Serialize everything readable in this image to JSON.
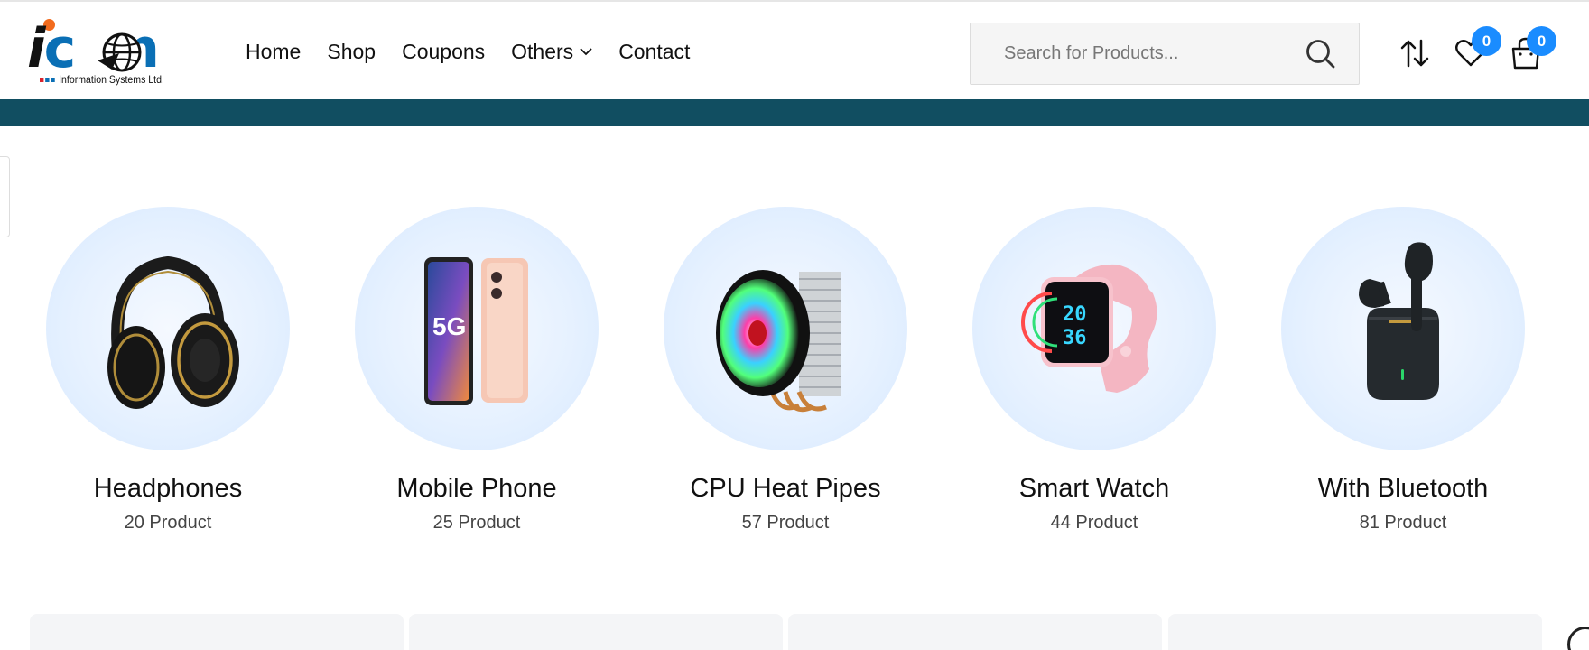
{
  "brand": {
    "logo_text": "icon",
    "tagline": "Information Systems Ltd.",
    "colors": {
      "primary": "#0a6fb5",
      "accent": "#f26b1d",
      "teal_bar": "#114e61",
      "badge": "#1a8cff"
    }
  },
  "nav": {
    "items": [
      {
        "label": "Home"
      },
      {
        "label": "Shop"
      },
      {
        "label": "Coupons"
      },
      {
        "label": "Others",
        "has_dropdown": true,
        "icon": "chevron-down-icon"
      },
      {
        "label": "Contact"
      }
    ]
  },
  "search": {
    "placeholder": "Search for Products...",
    "icon": "search-icon"
  },
  "header_actions": {
    "compare": {
      "icon": "compare-arrows-icon"
    },
    "wishlist": {
      "icon": "heart-icon",
      "count": "0"
    },
    "cart": {
      "icon": "shopping-bag-icon",
      "count": "0"
    }
  },
  "categories": [
    {
      "name": "Headphones",
      "count": "20 Product",
      "icon": "headphones-image"
    },
    {
      "name": "Mobile Phone",
      "count": "25 Product",
      "icon": "mobile-phone-image"
    },
    {
      "name": "CPU Heat Pipes",
      "count": "57 Product",
      "icon": "cpu-cooler-image"
    },
    {
      "name": "Smart Watch",
      "count": "44 Product",
      "icon": "smart-watch-image"
    },
    {
      "name": "With Bluetooth",
      "count": "81 Product",
      "icon": "bluetooth-earbuds-image"
    }
  ],
  "watch_display": {
    "line1": "20",
    "line2": "36"
  },
  "phone_display": {
    "badge": "5G"
  }
}
